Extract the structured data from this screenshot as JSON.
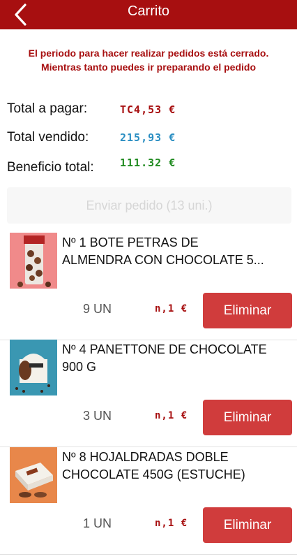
{
  "header": {
    "title": "Carrito",
    "back_icon": "chevron-left-icon",
    "background": "#a70f10"
  },
  "notice": {
    "line1": "El periodo para hacer realizar pedidos está cerrado.",
    "line2": "Mientras tanto puedes ir preparando el pedido"
  },
  "totals": {
    "to_pay_label": "Total a pagar:",
    "to_pay_value": "TC4,53 €",
    "sold_label": "Total vendido:",
    "sold_value": "215,93 €",
    "profit_label": "Beneficio total:",
    "profit_value": "111.32 €"
  },
  "send_button": {
    "label": "Enviar pedido (13 uni.)"
  },
  "items": [
    {
      "name_line1": "Nº 1 BOTE PETRAS DE",
      "name_line2": "ALMENDRA CON CHOCOLATE 5...",
      "qty": "9 UN",
      "price": "n,1 €",
      "delete_label": "Eliminar"
    },
    {
      "name_line1": "Nº 4 PANETTONE DE CHOCOLATE",
      "name_line2": "900 G",
      "qty": "3 UN",
      "price": "n,1 €",
      "delete_label": "Eliminar"
    },
    {
      "name_line1": "Nº 8 HOJALDRADAS DOBLE",
      "name_line2": "CHOCOLATE 450G (ESTUCHE)",
      "qty": "1 UN",
      "price": "n,1 €",
      "delete_label": "Eliminar"
    }
  ],
  "colors": {
    "brand_red": "#a70f10",
    "delete_red": "#d03c3c",
    "sold_blue": "#2a8ec2",
    "profit_green": "#1f8a1f"
  }
}
